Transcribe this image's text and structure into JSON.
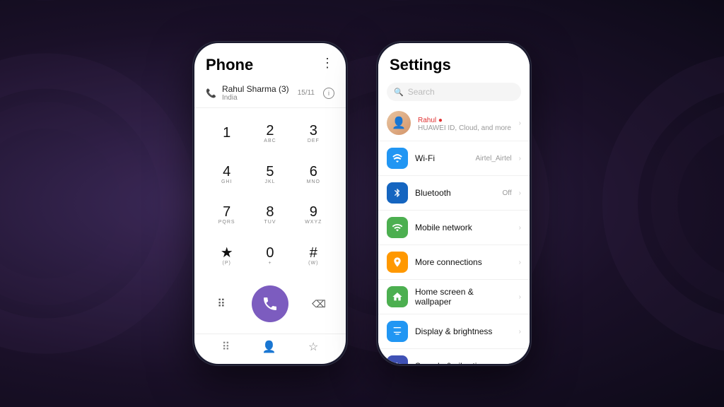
{
  "background": {
    "color": "#2d1f3d"
  },
  "phone1": {
    "title": "Phone",
    "menu_icon": "⋮",
    "contact": {
      "name": "Rahul Sharma (3)",
      "country": "India",
      "count": "15/11"
    },
    "dialpad": [
      {
        "num": "1",
        "letters": ""
      },
      {
        "num": "2",
        "letters": "ABC"
      },
      {
        "num": "3",
        "letters": "DEF"
      },
      {
        "num": "4",
        "letters": "GHI"
      },
      {
        "num": "5",
        "letters": "JKL"
      },
      {
        "num": "6",
        "letters": "MNO"
      },
      {
        "num": "7",
        "letters": "PQRS"
      },
      {
        "num": "8",
        "letters": "TUV"
      },
      {
        "num": "9",
        "letters": "WXYZ"
      },
      {
        "num": "★",
        "letters": "(P)"
      },
      {
        "num": "0",
        "letters": "+"
      },
      {
        "num": "#",
        "letters": "(W)"
      }
    ],
    "call_btn": "📞",
    "nav": {
      "dialpad_icon": "⠿",
      "contacts_icon": "👤",
      "favorites_icon": "☆"
    }
  },
  "phone2": {
    "title": "Settings",
    "search": {
      "placeholder": "Search"
    },
    "profile": {
      "name": "Rahul",
      "badge": "●",
      "sub": "HUAWEI ID, Cloud, and more"
    },
    "items": [
      {
        "icon": "wifi",
        "label": "Wi-Fi",
        "value": "Airtel_Airtel",
        "sub": ""
      },
      {
        "icon": "bluetooth",
        "label": "Bluetooth",
        "value": "Off",
        "sub": ""
      },
      {
        "icon": "mobile",
        "label": "Mobile network",
        "value": "",
        "sub": ""
      },
      {
        "icon": "connections",
        "label": "More connections",
        "value": "",
        "sub": ""
      },
      {
        "icon": "homescreen",
        "label": "Home screen & wallpaper",
        "value": "",
        "sub": ""
      },
      {
        "icon": "display",
        "label": "Display & brightness",
        "value": "",
        "sub": ""
      },
      {
        "icon": "sound",
        "label": "Sounds & vibration",
        "value": "",
        "sub": ""
      }
    ]
  }
}
